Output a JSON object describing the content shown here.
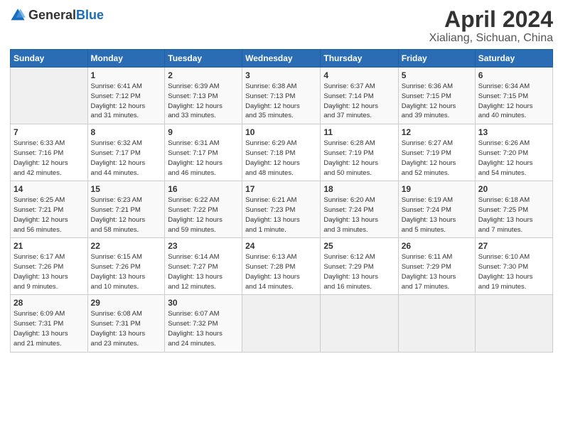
{
  "header": {
    "logo_general": "General",
    "logo_blue": "Blue",
    "title": "April 2024",
    "subtitle": "Xialiang, Sichuan, China"
  },
  "days_of_week": [
    "Sunday",
    "Monday",
    "Tuesday",
    "Wednesday",
    "Thursday",
    "Friday",
    "Saturday"
  ],
  "weeks": [
    [
      {
        "day": "",
        "info": ""
      },
      {
        "day": "1",
        "info": "Sunrise: 6:41 AM\nSunset: 7:12 PM\nDaylight: 12 hours\nand 31 minutes."
      },
      {
        "day": "2",
        "info": "Sunrise: 6:39 AM\nSunset: 7:13 PM\nDaylight: 12 hours\nand 33 minutes."
      },
      {
        "day": "3",
        "info": "Sunrise: 6:38 AM\nSunset: 7:13 PM\nDaylight: 12 hours\nand 35 minutes."
      },
      {
        "day": "4",
        "info": "Sunrise: 6:37 AM\nSunset: 7:14 PM\nDaylight: 12 hours\nand 37 minutes."
      },
      {
        "day": "5",
        "info": "Sunrise: 6:36 AM\nSunset: 7:15 PM\nDaylight: 12 hours\nand 39 minutes."
      },
      {
        "day": "6",
        "info": "Sunrise: 6:34 AM\nSunset: 7:15 PM\nDaylight: 12 hours\nand 40 minutes."
      }
    ],
    [
      {
        "day": "7",
        "info": "Sunrise: 6:33 AM\nSunset: 7:16 PM\nDaylight: 12 hours\nand 42 minutes."
      },
      {
        "day": "8",
        "info": "Sunrise: 6:32 AM\nSunset: 7:17 PM\nDaylight: 12 hours\nand 44 minutes."
      },
      {
        "day": "9",
        "info": "Sunrise: 6:31 AM\nSunset: 7:17 PM\nDaylight: 12 hours\nand 46 minutes."
      },
      {
        "day": "10",
        "info": "Sunrise: 6:29 AM\nSunset: 7:18 PM\nDaylight: 12 hours\nand 48 minutes."
      },
      {
        "day": "11",
        "info": "Sunrise: 6:28 AM\nSunset: 7:19 PM\nDaylight: 12 hours\nand 50 minutes."
      },
      {
        "day": "12",
        "info": "Sunrise: 6:27 AM\nSunset: 7:19 PM\nDaylight: 12 hours\nand 52 minutes."
      },
      {
        "day": "13",
        "info": "Sunrise: 6:26 AM\nSunset: 7:20 PM\nDaylight: 12 hours\nand 54 minutes."
      }
    ],
    [
      {
        "day": "14",
        "info": "Sunrise: 6:25 AM\nSunset: 7:21 PM\nDaylight: 12 hours\nand 56 minutes."
      },
      {
        "day": "15",
        "info": "Sunrise: 6:23 AM\nSunset: 7:21 PM\nDaylight: 12 hours\nand 58 minutes."
      },
      {
        "day": "16",
        "info": "Sunrise: 6:22 AM\nSunset: 7:22 PM\nDaylight: 12 hours\nand 59 minutes."
      },
      {
        "day": "17",
        "info": "Sunrise: 6:21 AM\nSunset: 7:23 PM\nDaylight: 13 hours\nand 1 minute."
      },
      {
        "day": "18",
        "info": "Sunrise: 6:20 AM\nSunset: 7:24 PM\nDaylight: 13 hours\nand 3 minutes."
      },
      {
        "day": "19",
        "info": "Sunrise: 6:19 AM\nSunset: 7:24 PM\nDaylight: 13 hours\nand 5 minutes."
      },
      {
        "day": "20",
        "info": "Sunrise: 6:18 AM\nSunset: 7:25 PM\nDaylight: 13 hours\nand 7 minutes."
      }
    ],
    [
      {
        "day": "21",
        "info": "Sunrise: 6:17 AM\nSunset: 7:26 PM\nDaylight: 13 hours\nand 9 minutes."
      },
      {
        "day": "22",
        "info": "Sunrise: 6:15 AM\nSunset: 7:26 PM\nDaylight: 13 hours\nand 10 minutes."
      },
      {
        "day": "23",
        "info": "Sunrise: 6:14 AM\nSunset: 7:27 PM\nDaylight: 13 hours\nand 12 minutes."
      },
      {
        "day": "24",
        "info": "Sunrise: 6:13 AM\nSunset: 7:28 PM\nDaylight: 13 hours\nand 14 minutes."
      },
      {
        "day": "25",
        "info": "Sunrise: 6:12 AM\nSunset: 7:29 PM\nDaylight: 13 hours\nand 16 minutes."
      },
      {
        "day": "26",
        "info": "Sunrise: 6:11 AM\nSunset: 7:29 PM\nDaylight: 13 hours\nand 17 minutes."
      },
      {
        "day": "27",
        "info": "Sunrise: 6:10 AM\nSunset: 7:30 PM\nDaylight: 13 hours\nand 19 minutes."
      }
    ],
    [
      {
        "day": "28",
        "info": "Sunrise: 6:09 AM\nSunset: 7:31 PM\nDaylight: 13 hours\nand 21 minutes."
      },
      {
        "day": "29",
        "info": "Sunrise: 6:08 AM\nSunset: 7:31 PM\nDaylight: 13 hours\nand 23 minutes."
      },
      {
        "day": "30",
        "info": "Sunrise: 6:07 AM\nSunset: 7:32 PM\nDaylight: 13 hours\nand 24 minutes."
      },
      {
        "day": "",
        "info": ""
      },
      {
        "day": "",
        "info": ""
      },
      {
        "day": "",
        "info": ""
      },
      {
        "day": "",
        "info": ""
      }
    ]
  ]
}
